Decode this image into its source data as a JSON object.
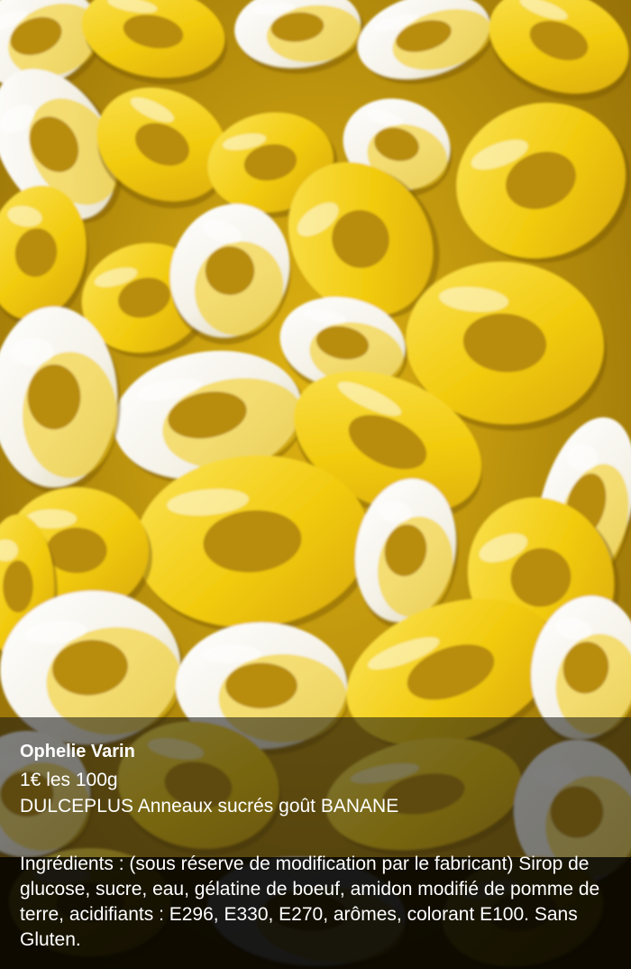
{
  "post": {
    "author": "Ophelie Varin",
    "price": "1€ les 100g",
    "product": "DULCEPLUS Anneaux sucrés goût BANANE",
    "ingredients": "Ingrédients : (sous réserve de modification par le fabricant) Sirop de glucose, sucre, eau, gélatine de boeuf, amidon modifié de pomme de terre, acidifiants : E296, E330, E270, arômes, colorant E100. Sans Gluten."
  },
  "colors": {
    "candy_yellow": "#f2cc10",
    "candy_white": "#f6f4ee",
    "shadow_amber": "#b58a08",
    "caption_text": "#ffffff"
  }
}
